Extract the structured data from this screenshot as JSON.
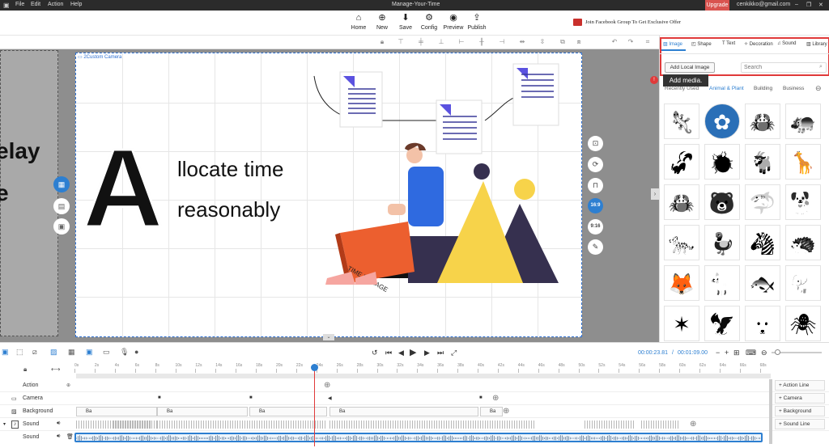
{
  "titlebar": {
    "menu": [
      "File",
      "Edit",
      "Action",
      "Help"
    ],
    "title": "Manage-Your-Time",
    "upgrade": "Upgrade",
    "user": "cenkikko@gmail.com"
  },
  "toolbar": {
    "buttons": [
      {
        "label": "Home",
        "icon": "home-icon"
      },
      {
        "label": "New",
        "icon": "plus-icon"
      },
      {
        "label": "Save",
        "icon": "save-icon"
      },
      {
        "label": "Config",
        "icon": "gear-icon"
      },
      {
        "label": "Preview",
        "icon": "eye-icon"
      },
      {
        "label": "Publish",
        "icon": "export-icon"
      }
    ],
    "promo": "Join Facebook Group To Get Exclusive Offer"
  },
  "canvas": {
    "scene_label": "2Custom Camera",
    "left_text_1": "elay",
    "left_text_2": "e",
    "big_letter": "A",
    "line1": "llocate time",
    "line2": "reasonably",
    "book_text": "TIME MANAGE",
    "ratio_169": "16:9",
    "ratio_916": "9:16"
  },
  "panel": {
    "tabs": [
      "Image",
      "Shape",
      "Text",
      "Decoration",
      "Sound",
      "Library"
    ],
    "add_local": "Add Local Image",
    "search_placeholder": "Search",
    "tooltip": "Add media.",
    "categories": [
      "Recently Used",
      "Animal & Plant",
      "Building",
      "Business"
    ],
    "active_category": "Animal & Plant",
    "accent": "#2d7fd1",
    "thumbs": [
      "lizard",
      "dandelion",
      "crab",
      "hippo",
      "skunk",
      "ladybug",
      "goat",
      "giraffe",
      "crab-outline",
      "polar-bear",
      "shark",
      "pup",
      "cheetah",
      "duck",
      "zebra",
      "hedgehog",
      "fox",
      "panther",
      "fish",
      "elephant",
      "starfish",
      "eagle",
      "wolf",
      "spider"
    ]
  },
  "timeline": {
    "current_time": "00:00:23.81",
    "total_time": "00:01:09.00",
    "ticks": [
      "0s",
      "2s",
      "4s",
      "6s",
      "8s",
      "10s",
      "12s",
      "14s",
      "16s",
      "18s",
      "20s",
      "22s",
      "24s",
      "26s",
      "28s",
      "30s",
      "32s",
      "34s",
      "36s",
      "38s",
      "40s",
      "42s",
      "44s",
      "46s",
      "48s",
      "50s",
      "52s",
      "54s",
      "56s",
      "58s",
      "60s",
      "62s",
      "64s",
      "66s",
      "68s"
    ],
    "rows": [
      {
        "label": "Action",
        "right": "Action Line"
      },
      {
        "label": "Camera",
        "right": "Camera"
      },
      {
        "label": "Background",
        "right": "Background"
      },
      {
        "label": "Sound",
        "right": "Sound Line"
      },
      {
        "label": "Sound",
        "right": ""
      }
    ],
    "bg_clip": "Ba"
  }
}
